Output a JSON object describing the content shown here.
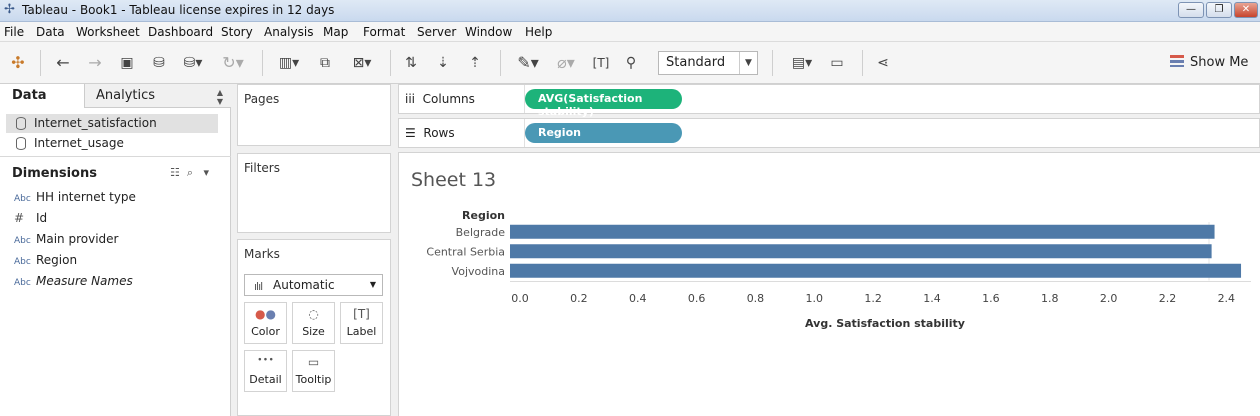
{
  "window": {
    "title": "Tableau - Book1 - Tableau license expires in 12 days"
  },
  "menu": [
    "File",
    "Data",
    "Worksheet",
    "Dashboard",
    "Story",
    "Analysis",
    "Map",
    "Format",
    "Server",
    "Window",
    "Help"
  ],
  "toolbar": {
    "view_mode": "Standard",
    "show_me": "Show Me"
  },
  "data_pane": {
    "tabs": {
      "data": "Data",
      "analytics": "Analytics"
    },
    "datasources": [
      "Internet_satisfaction",
      "Internet_usage"
    ],
    "dimensions_title": "Dimensions",
    "dimensions": [
      {
        "type": "Abc",
        "name": "HH internet type"
      },
      {
        "type": "#",
        "name": "Id"
      },
      {
        "type": "Abc",
        "name": "Main provider"
      },
      {
        "type": "Abc",
        "name": "Region"
      },
      {
        "type": "Abc",
        "name": "Measure Names"
      }
    ]
  },
  "cards": {
    "pages": "Pages",
    "filters": "Filters",
    "marks": "Marks",
    "mark_type": "Automatic",
    "mark_buttons": [
      "Color",
      "Size",
      "Label",
      "Detail",
      "Tooltip"
    ]
  },
  "shelves": {
    "columns_label": "Columns",
    "columns_pill": "AVG(Satisfaction stability)",
    "rows_label": "Rows",
    "rows_pill": "Region"
  },
  "colors": {
    "measure_pill": "#1db37a",
    "dimension_pill": "#4a98b5",
    "bar": "#4e79a7"
  },
  "sheet": {
    "title": "Sheet 13"
  },
  "chart_data": {
    "type": "bar",
    "orientation": "horizontal",
    "row_header": "Region",
    "categories": [
      "Belgrade",
      "Central Serbia",
      "Vojvodina"
    ],
    "values": [
      2.36,
      2.35,
      2.45
    ],
    "xlabel": "Avg. Satisfaction stability",
    "xlim": [
      0,
      2.5
    ],
    "ticks": [
      "0.0",
      "0.2",
      "0.4",
      "0.6",
      "0.8",
      "1.0",
      "1.2",
      "1.4",
      "1.6",
      "1.8",
      "2.0",
      "2.2",
      "2.4"
    ]
  }
}
